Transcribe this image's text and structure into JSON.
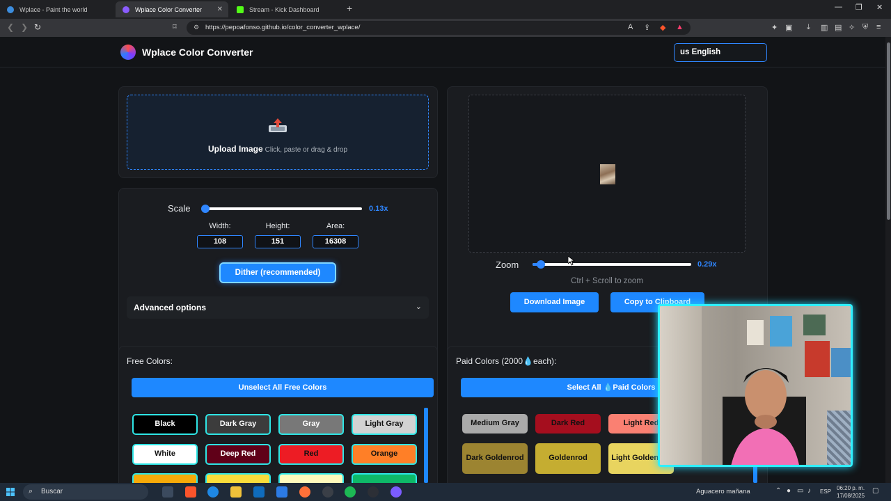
{
  "browser": {
    "tabs": [
      {
        "title": "Wplace - Paint the world",
        "active": false
      },
      {
        "title": "Wplace Color Converter",
        "active": true
      },
      {
        "title": "Stream - Kick Dashboard",
        "active": false
      }
    ],
    "url": "https://pepoafonso.github.io/color_converter_wplace/"
  },
  "header": {
    "title": "Wplace Color Converter",
    "language": "us English"
  },
  "upload": {
    "label": "Upload Image",
    "hint": "Click, paste or drag & drop"
  },
  "scale": {
    "label": "Scale",
    "value": "0.13x",
    "width_label": "Width:",
    "height_label": "Height:",
    "area_label": "Area:",
    "width": "108",
    "height": "151",
    "area": "16308"
  },
  "dither_button": "Dither (recommended)",
  "advanced_options": "Advanced options",
  "zoom": {
    "label": "Zoom",
    "value": "0.29x",
    "hint": "Ctrl + Scroll to zoom"
  },
  "actions": {
    "download": "Download Image",
    "copy": "Copy to Clipboard"
  },
  "free_colors": {
    "title": "Free Colors:",
    "unselect_button": "Unselect All Free Colors",
    "items": [
      {
        "label": "Black",
        "bg": "#000000",
        "fg": "#ffffff"
      },
      {
        "label": "Dark Gray",
        "bg": "#3c3c3c",
        "fg": "#ffffff"
      },
      {
        "label": "Gray",
        "bg": "#787878",
        "fg": "#ffffff"
      },
      {
        "label": "Light Gray",
        "bg": "#d2d2d2",
        "fg": "#111111"
      },
      {
        "label": "White",
        "bg": "#ffffff",
        "fg": "#111111"
      },
      {
        "label": "Deep Red",
        "bg": "#600018",
        "fg": "#ffffff"
      },
      {
        "label": "Red",
        "bg": "#ed1c24",
        "fg": "#111111"
      },
      {
        "label": "Orange",
        "bg": "#ff7f27",
        "fg": "#111111"
      }
    ]
  },
  "paid_colors": {
    "title": "Paid Colors (2000💧each):",
    "select_button": "Select All 💧Paid Colors",
    "items": [
      {
        "label": "Medium Gray",
        "bg": "#aaaaaa",
        "fg": "#111111"
      },
      {
        "label": "Dark Red",
        "bg": "#a50e1e",
        "fg": "#111111"
      },
      {
        "label": "Light Red",
        "bg": "#fa8072",
        "fg": "#111111"
      },
      {
        "label": "Dark Goldenrod",
        "bg": "#9c8431",
        "fg": "#111111"
      },
      {
        "label": "Goldenrod",
        "bg": "#c5ad31",
        "fg": "#111111"
      },
      {
        "label": "Light Goldenrod",
        "bg": "#e8d45f",
        "fg": "#111111"
      }
    ]
  },
  "taskbar": {
    "search_placeholder": "Buscar",
    "weather": "Aguacero mañana",
    "lang": "ESP",
    "time": "06:20 p. m.",
    "date": "17/08/2025"
  },
  "colors": {
    "accent": "#1e88ff",
    "selected_outline": "#2ee6e6",
    "page_bg": "#121417"
  }
}
